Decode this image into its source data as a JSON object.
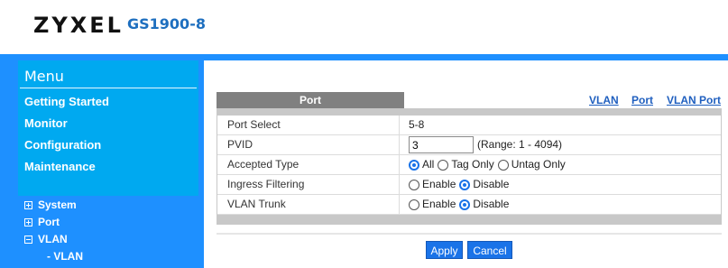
{
  "header": {
    "logo": "ZYXEL",
    "model": "GS1900-8"
  },
  "menu": {
    "title": "Menu",
    "items": [
      "Getting Started",
      "Monitor",
      "Configuration",
      "Maintenance"
    ]
  },
  "tree": {
    "system": "System",
    "port": "Port",
    "vlan": "VLAN",
    "vlan_sub": "- VLAN"
  },
  "tabs": {
    "active": "Port",
    "links": [
      "VLAN",
      "Port",
      "VLAN Port"
    ]
  },
  "form": {
    "port_select": {
      "label": "Port Select",
      "value": "5-8"
    },
    "pvid": {
      "label": "PVID",
      "value": "3",
      "range": "(Range: 1 - 4094)"
    },
    "accepted_type": {
      "label": "Accepted Type",
      "options": [
        "All",
        "Tag Only",
        "Untag Only"
      ],
      "selected": "All"
    },
    "ingress_filtering": {
      "label": "Ingress Filtering",
      "options": [
        "Enable",
        "Disable"
      ],
      "selected": "Disable"
    },
    "vlan_trunk": {
      "label": "VLAN Trunk",
      "options": [
        "Enable",
        "Disable"
      ],
      "selected": "Disable"
    }
  },
  "buttons": {
    "apply": "Apply",
    "cancel": "Cancel"
  },
  "colors": {
    "frame": "#1e90ff",
    "menu": "#00a9f0",
    "button": "#1a73e8",
    "link": "#1f5fbf"
  }
}
